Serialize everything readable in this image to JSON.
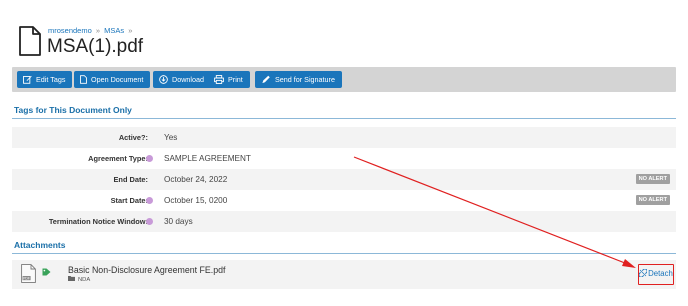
{
  "breadcrumb": {
    "items": [
      "mrosendemo",
      "MSAs"
    ],
    "separator": "»"
  },
  "document": {
    "title": "MSA(1).pdf"
  },
  "toolbar": {
    "edit_tags": "Edit Tags",
    "open_document": "Open Document",
    "download": "Download",
    "print": "Print",
    "send_for_signature": "Send for Signature"
  },
  "tags_section": {
    "title": "Tags for This Document Only",
    "rows": [
      {
        "label": "Active?:",
        "value": "Yes",
        "has_dot": false,
        "alert": ""
      },
      {
        "label": "Agreement Type:",
        "value": "SAMPLE AGREEMENT",
        "has_dot": true,
        "alert": ""
      },
      {
        "label": "End Date:",
        "value": "October 24, 2022",
        "has_dot": false,
        "alert": "NO ALERT"
      },
      {
        "label": "Start Date:",
        "value": "October 15, 0200",
        "has_dot": true,
        "alert": "NO ALERT"
      },
      {
        "label": "Termination Notice Window:",
        "value": "30 days",
        "has_dot": true,
        "alert": ""
      }
    ]
  },
  "attachments_section": {
    "title": "Attachments",
    "items": [
      {
        "name": "Basic Non-Disclosure Agreement FE.pdf",
        "tag": "NDA",
        "action": "Detach"
      }
    ]
  },
  "colors": {
    "accent": "#1a75bb",
    "tag_dot": "#c89ad8",
    "annotation": "#e02020"
  },
  "icons": {
    "edit_tags": "edit-icon",
    "open_document": "document-icon",
    "download": "download-icon",
    "print": "printer-icon",
    "send_for_signature": "pen-icon",
    "tag": "tag-icon",
    "folder": "folder-icon",
    "detach": "unlink-icon"
  }
}
